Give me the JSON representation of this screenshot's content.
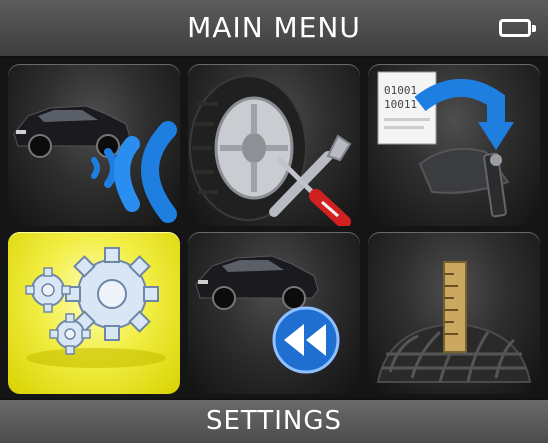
{
  "header": {
    "title": "MAIN MENU",
    "battery_icon": "battery-full-icon"
  },
  "menu": {
    "selected_index": 3,
    "items": [
      {
        "icon": "car-wireless-trigger-icon"
      },
      {
        "icon": "tire-service-tools-icon"
      },
      {
        "icon": "sensor-programming-icon"
      },
      {
        "icon": "settings-gears-icon"
      },
      {
        "icon": "car-rewind-icon"
      },
      {
        "icon": "tire-tread-depth-icon"
      }
    ],
    "sensor_code_lines": [
      "01001",
      "10011"
    ]
  },
  "footer": {
    "status": "SETTINGS"
  },
  "colors": {
    "selected_tile": "#f2ee44",
    "signal_blue": "#1f7fe0",
    "header_bg": "#4a4a4a"
  }
}
